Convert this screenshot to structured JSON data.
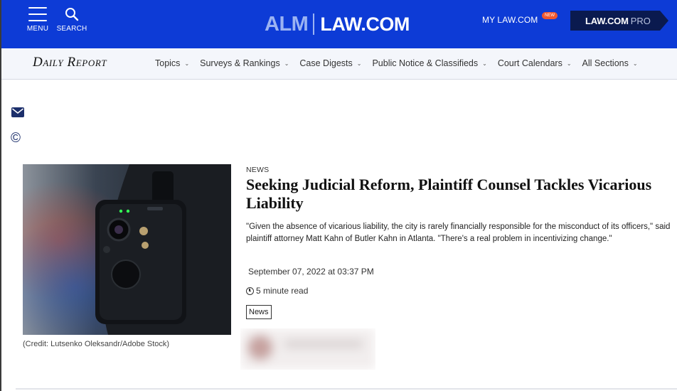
{
  "header": {
    "menu_label": "MENU",
    "search_label": "SEARCH",
    "logo_alm": "ALM",
    "logo_law": "LAW.COM",
    "my_law_label": "MY LAW.COM",
    "new_badge": "NEW",
    "pro_main": "LAW.COM",
    "pro_sub": "PRO",
    "colors": {
      "bar": "#0d3bd6",
      "pro_button": "#0a1a4f",
      "badge": "#f0572d"
    }
  },
  "nav": {
    "brand": "Daily Report",
    "items": [
      {
        "label": "Topics"
      },
      {
        "label": "Surveys & Rankings"
      },
      {
        "label": "Case Digests"
      },
      {
        "label": "Public Notice & Classifieds"
      },
      {
        "label": "Court Calendars"
      },
      {
        "label": "All Sections"
      }
    ]
  },
  "side_icons": [
    "mail-icon",
    "copyright-icon"
  ],
  "copyright_symbol": "©",
  "article": {
    "kicker": "NEWS",
    "headline": "Seeking Judicial Reform, Plaintiff Counsel Tackles Vicarious Liability",
    "summary": "\"Given the absence of vicarious liability, the city is rarely financially responsible for the misconduct of its officers,\" said plaintiff attorney Matt Kahn of Butler Kahn in Atlanta. \"There's a real problem in incentivizing change.\"",
    "date": "September 07, 2022 at 03:37 PM",
    "read_time": "5 minute read",
    "tag": "News",
    "image_caption": "(Credit: Lutsenko Oleksandr/Adobe Stock)"
  }
}
